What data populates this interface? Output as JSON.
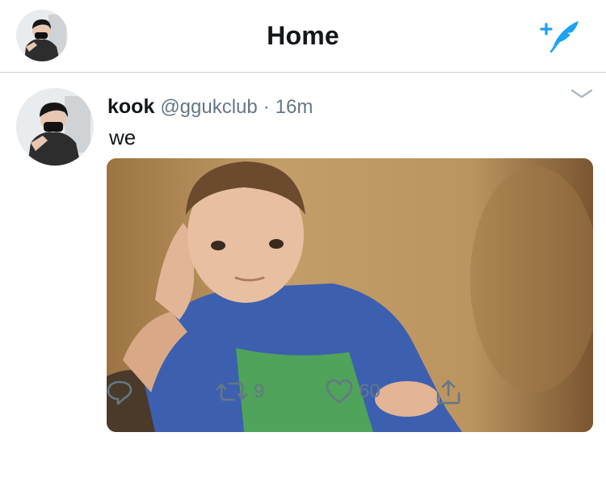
{
  "header": {
    "title": "Home",
    "avatar_icon": "profile-avatar",
    "compose_icon": "compose-tweet-icon",
    "accent_color": "#1da1f2"
  },
  "tweet": {
    "display_name": "kook",
    "handle": "@ggukclub",
    "separator": "·",
    "timestamp": "16m",
    "text": "we",
    "media_icon": "photo",
    "actions": {
      "reply_icon": "reply-icon",
      "retweet_icon": "retweet-icon",
      "retweet_count": "9",
      "like_icon": "heart-icon",
      "like_count": "60",
      "share_icon": "share-icon"
    }
  }
}
